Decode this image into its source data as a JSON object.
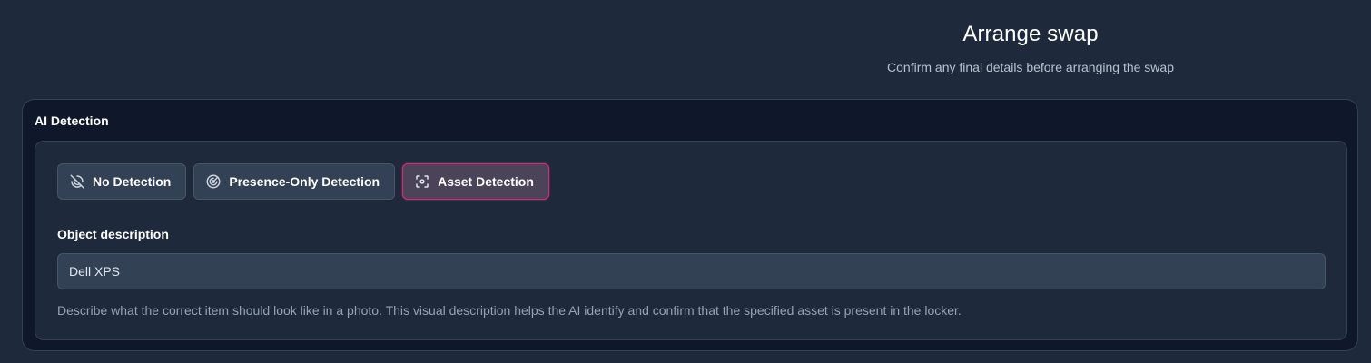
{
  "header": {
    "title": "Arrange swap",
    "subtitle": "Confirm any final details before arranging the swap"
  },
  "ai_detection": {
    "section_title": "AI Detection",
    "options": [
      {
        "label": "No Detection",
        "icon": "no-detection-icon",
        "selected": false
      },
      {
        "label": "Presence-Only Detection",
        "icon": "radar-icon",
        "selected": false
      },
      {
        "label": "Asset Detection",
        "icon": "scan-focus-icon",
        "selected": true
      }
    ],
    "object_description": {
      "label": "Object description",
      "value": "Dell XPS",
      "help_text": "Describe what the correct item should look like in a photo. This visual description helps the AI identify and confirm that the specified asset is present in the locker."
    }
  },
  "colors": {
    "page_background": "#1e293b",
    "card_background": "#0f172a",
    "panel_background": "#1e293b",
    "button_background": "#334155",
    "selected_background": "#4b4459",
    "selected_border": "#db2777",
    "muted_text": "#94a3b8"
  }
}
